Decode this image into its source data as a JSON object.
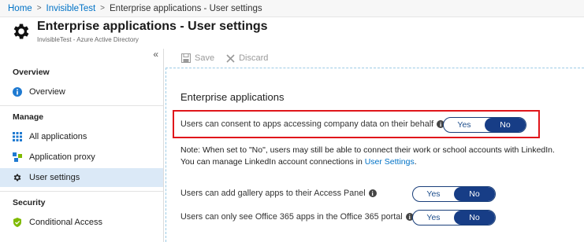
{
  "breadcrumb": {
    "home": "Home",
    "tenant": "InvisibleTest",
    "current": "Enterprise applications - User settings",
    "separator": ">"
  },
  "header": {
    "title": "Enterprise applications - User settings",
    "subtitle": "InvisibleTest - Azure Active Directory",
    "icon": "gear-icon"
  },
  "sidebar": {
    "collapse_glyph": "«",
    "sections": {
      "overview": "Overview",
      "manage": "Manage",
      "security": "Security"
    },
    "items": {
      "overview": "Overview",
      "all_applications": "All applications",
      "application_proxy": "Application proxy",
      "user_settings": "User settings",
      "conditional_access": "Conditional Access"
    },
    "active": "user_settings"
  },
  "toolbar": {
    "save": "Save",
    "discard": "Discard"
  },
  "main": {
    "section_title": "Enterprise applications",
    "settings": [
      {
        "label": "Users can consent to apps accessing company data on their behalf",
        "yes": "Yes",
        "no": "No",
        "selected": "No"
      },
      {
        "label": "Users can add gallery apps to their Access Panel",
        "yes": "Yes",
        "no": "No",
        "selected": "No"
      },
      {
        "label": "Users can only see Office 365 apps in the Office 365 portal",
        "yes": "Yes",
        "no": "No",
        "selected": "No"
      }
    ],
    "note": {
      "line1": "Note: When set to \"No\", users may still be able to connect their work or school accounts with LinkedIn.",
      "line2_prefix": "You can manage LinkedIn account connections in ",
      "link": "User Settings",
      "line2_suffix": "."
    }
  },
  "colors": {
    "accent": "#0072c6",
    "highlight_border": "#e0161b",
    "toggle_selected": "#173d86",
    "active_nav": "#dbe9f7"
  }
}
